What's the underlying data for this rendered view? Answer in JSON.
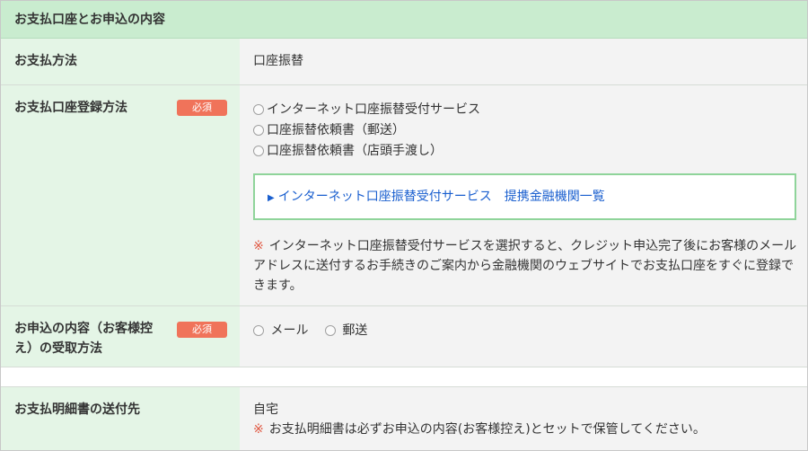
{
  "header": {
    "title": "お支払口座とお申込の内容"
  },
  "payment_method": {
    "label": "お支払方法",
    "value": "口座振替"
  },
  "account_registration": {
    "label": "お支払口座登録方法",
    "required_badge": "必須",
    "options": [
      {
        "label": "インターネット口座振替受付サービス"
      },
      {
        "label": "口座振替依頼書（郵送）"
      },
      {
        "label": "口座振替依頼書（店頭手渡し）"
      }
    ],
    "link_text": "インターネット口座振替受付サービス　提携金融機関一覧",
    "note_mark": "※",
    "note": "インターネット口座振替受付サービスを選択すると、クレジット申込完了後にお客様のメールアドレスに送付するお手続きのご案内から金融機関のウェブサイトでお支払口座をすぐに登録できます。"
  },
  "receipt_method": {
    "label_line1": "お申込の内容（お客様控",
    "label_line2": "え）の受取方法",
    "required_badge": "必須",
    "options": [
      {
        "label": "メール"
      },
      {
        "label": "郵送"
      }
    ]
  },
  "statement_destination": {
    "label": "お支払明細書の送付先",
    "value": "自宅",
    "note_mark": "※",
    "note": "お支払明細書は必ずお申込の内容(お客様控え)とセットで保管してください。"
  },
  "colors": {
    "header_bg": "#c9eccf",
    "label_bg": "#e4f5e6",
    "badge": "#f0735a",
    "link": "#1a5fcf",
    "note_mark": "#e05a44"
  }
}
